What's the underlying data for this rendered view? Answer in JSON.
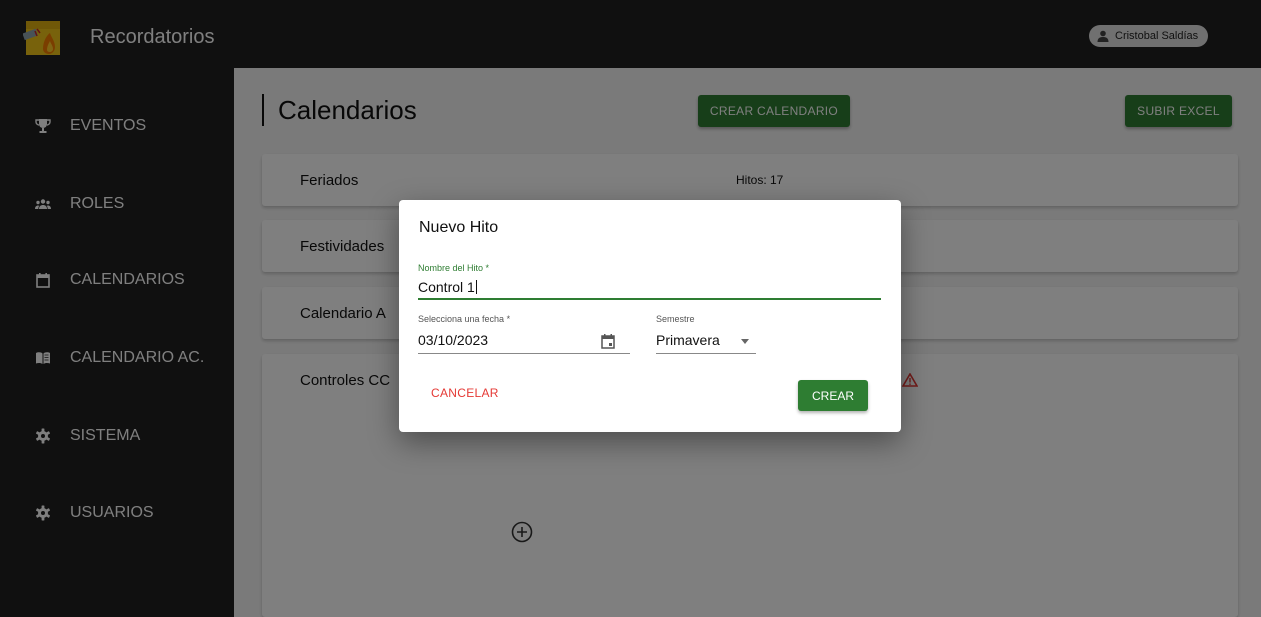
{
  "app": {
    "title": "Recordatorios"
  },
  "user": {
    "name": "Cristobal Saldías"
  },
  "sidebar": {
    "items": [
      {
        "label": "EVENTOS",
        "icon": "trophy-icon"
      },
      {
        "label": "ROLES",
        "icon": "group-icon"
      },
      {
        "label": "CALENDARIOS",
        "icon": "calendar-icon"
      },
      {
        "label": "CALENDARIO AC.",
        "icon": "book-icon"
      },
      {
        "label": "SISTEMA",
        "icon": "gear-icon"
      },
      {
        "label": "USUARIOS",
        "icon": "gear-icon"
      }
    ]
  },
  "main": {
    "title": "Calendarios",
    "create_calendar_label": "CREAR CALENDARIO",
    "upload_excel_label": "SUBIR EXCEL",
    "calendars": [
      {
        "name": "Feriados",
        "hitos": "Hitos: 17"
      },
      {
        "name": "Festividades"
      },
      {
        "name": "Calendario A"
      },
      {
        "name": "Controles CC"
      }
    ]
  },
  "dialog": {
    "title": "Nuevo Hito",
    "name_label": "Nombre del Hito *",
    "name_value": "Control 1",
    "date_label": "Selecciona una fecha *",
    "date_value": "03/10/2023",
    "semester_label": "Semestre",
    "semester_value": "Primavera",
    "cancel_label": "CANCELAR",
    "create_label": "CREAR"
  },
  "colors": {
    "topbar": "#212121",
    "accent_green": "#2e7d32",
    "cancel_red": "#e53935",
    "warning": "#e53935"
  }
}
